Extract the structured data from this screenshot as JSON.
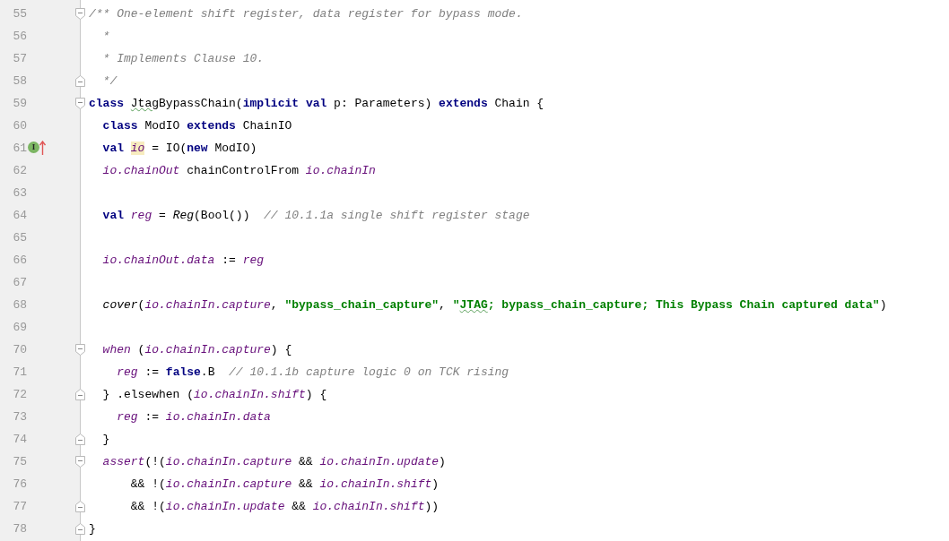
{
  "lines": [
    {
      "number": "55",
      "fold_open": true,
      "tokens": [
        {
          "text": "/** One-element shift register, data register for bypass mode.",
          "kind": "comment"
        }
      ]
    },
    {
      "number": "56",
      "tokens": [
        {
          "text": "  *",
          "kind": "comment"
        }
      ]
    },
    {
      "number": "57",
      "tokens": [
        {
          "text": "  * Implements Clause 10.",
          "kind": "comment"
        }
      ]
    },
    {
      "number": "58",
      "fold_close": true,
      "tokens": [
        {
          "text": "  */",
          "kind": "comment"
        }
      ]
    },
    {
      "number": "59",
      "fold_open": true,
      "tokens": [
        {
          "text": "class ",
          "kind": "keyword"
        },
        {
          "text": "Jtag",
          "kind": "plain",
          "typo": true
        },
        {
          "text": "BypassChain(",
          "kind": "plain"
        },
        {
          "text": "implicit ",
          "kind": "keyword"
        },
        {
          "text": "val",
          "kind": "keyword"
        },
        {
          "text": " p: Parameters) ",
          "kind": "plain"
        },
        {
          "text": "extends",
          "kind": "keyword"
        },
        {
          "text": " Chain {",
          "kind": "plain"
        }
      ]
    },
    {
      "number": "60",
      "tokens": [
        {
          "text": "  class",
          "kind": "keyword"
        },
        {
          "text": " ModIO ",
          "kind": "plain"
        },
        {
          "text": "extends",
          "kind": "keyword"
        },
        {
          "text": " ChainIO",
          "kind": "plain"
        }
      ]
    },
    {
      "number": "61",
      "markers": [
        {
          "kind": "badge",
          "text": "I"
        },
        {
          "kind": "arrow"
        }
      ],
      "tokens": [
        {
          "text": "  val ",
          "kind": "keyword"
        },
        {
          "text": "io",
          "kind": "field",
          "highlighted": true
        },
        {
          "text": " = IO(",
          "kind": "plain"
        },
        {
          "text": "new",
          "kind": "keyword"
        },
        {
          "text": " ModIO)",
          "kind": "plain"
        }
      ]
    },
    {
      "number": "62",
      "tokens": [
        {
          "text": "  io.chainOut",
          "kind": "field"
        },
        {
          "text": " chainControlFrom ",
          "kind": "plain"
        },
        {
          "text": "io.chainIn",
          "kind": "field"
        }
      ]
    },
    {
      "number": "63"
    },
    {
      "number": "64",
      "tokens": [
        {
          "text": "  val ",
          "kind": "keyword"
        },
        {
          "text": "reg",
          "kind": "field"
        },
        {
          "text": " = ",
          "kind": "plain"
        },
        {
          "text": "Reg",
          "kind": "call"
        },
        {
          "text": "(Bool())  ",
          "kind": "plain"
        },
        {
          "text": "// 10.1.1a single shift register stage",
          "kind": "comment"
        }
      ]
    },
    {
      "number": "65"
    },
    {
      "number": "66",
      "tokens": [
        {
          "text": "  io.chainOut.data",
          "kind": "field"
        },
        {
          "text": " := ",
          "kind": "plain"
        },
        {
          "text": "reg",
          "kind": "field"
        }
      ]
    },
    {
      "number": "67"
    },
    {
      "number": "68",
      "tokens": [
        {
          "text": "  cover",
          "kind": "call"
        },
        {
          "text": "(",
          "kind": "plain"
        },
        {
          "text": "io.chainIn.capture",
          "kind": "field"
        },
        {
          "text": ", ",
          "kind": "plain"
        },
        {
          "text": "\"bypass_chain_capture\"",
          "kind": "string"
        },
        {
          "text": ", ",
          "kind": "plain"
        },
        {
          "text": "\"",
          "kind": "string"
        },
        {
          "text": "JTAG",
          "kind": "string",
          "typo": true
        },
        {
          "text": "; bypass_chain_capture; This Bypass Chain captured data\"",
          "kind": "string"
        },
        {
          "text": ")",
          "kind": "plain"
        }
      ]
    },
    {
      "number": "69"
    },
    {
      "number": "70",
      "fold_open": true,
      "tokens": [
        {
          "text": "  when",
          "kind": "field"
        },
        {
          "text": " (",
          "kind": "plain"
        },
        {
          "text": "io.chainIn.capture",
          "kind": "field"
        },
        {
          "text": ") {",
          "kind": "plain"
        }
      ]
    },
    {
      "number": "71",
      "tokens": [
        {
          "text": "    reg",
          "kind": "field"
        },
        {
          "text": " := ",
          "kind": "plain"
        },
        {
          "text": "false",
          "kind": "keyword"
        },
        {
          "text": ".B  ",
          "kind": "plain"
        },
        {
          "text": "// 10.1.1b capture logic 0 on TCK rising",
          "kind": "comment"
        }
      ]
    },
    {
      "number": "72",
      "fold_close": true,
      "tokens": [
        {
          "text": "  } .elsewhen (",
          "kind": "plain"
        },
        {
          "text": "io.chainIn.shift",
          "kind": "field"
        },
        {
          "text": ") {",
          "kind": "plain"
        }
      ]
    },
    {
      "number": "73",
      "tokens": [
        {
          "text": "    reg",
          "kind": "field"
        },
        {
          "text": " := ",
          "kind": "plain"
        },
        {
          "text": "io.chainIn.data",
          "kind": "field"
        }
      ]
    },
    {
      "number": "74",
      "fold_close": true,
      "tokens": [
        {
          "text": "  }",
          "kind": "plain"
        }
      ]
    },
    {
      "number": "75",
      "fold_open": true,
      "tokens": [
        {
          "text": "  assert",
          "kind": "field"
        },
        {
          "text": "(!(",
          "kind": "plain"
        },
        {
          "text": "io.chainIn.capture",
          "kind": "field"
        },
        {
          "text": " && ",
          "kind": "plain"
        },
        {
          "text": "io.chainIn.update",
          "kind": "field"
        },
        {
          "text": ")",
          "kind": "plain"
        }
      ]
    },
    {
      "number": "76",
      "tokens": [
        {
          "text": "      && !(",
          "kind": "plain"
        },
        {
          "text": "io.chainIn.capture",
          "kind": "field"
        },
        {
          "text": " && ",
          "kind": "plain"
        },
        {
          "text": "io.chainIn.shift",
          "kind": "field"
        },
        {
          "text": ")",
          "kind": "plain"
        }
      ]
    },
    {
      "number": "77",
      "fold_close": true,
      "tokens": [
        {
          "text": "      && !(",
          "kind": "plain"
        },
        {
          "text": "io.chainIn.update",
          "kind": "field"
        },
        {
          "text": " && ",
          "kind": "plain"
        },
        {
          "text": "io.chainIn.shift",
          "kind": "field"
        },
        {
          "text": "))",
          "kind": "plain"
        }
      ]
    },
    {
      "number": "78",
      "fold_close": true,
      "tokens": [
        {
          "text": "}",
          "kind": "plain"
        }
      ]
    }
  ]
}
